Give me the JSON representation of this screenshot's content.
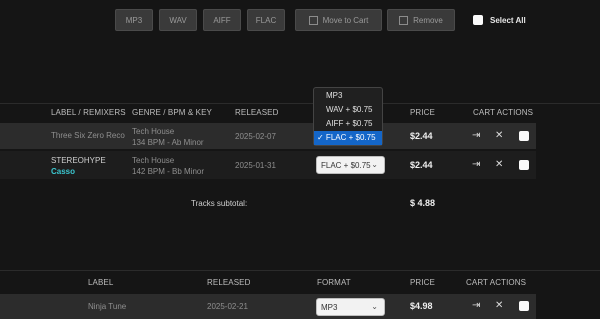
{
  "toolbar": {
    "formats": [
      "MP3",
      "WAV",
      "AIFF",
      "FLAC"
    ],
    "move_to_cart": "Move to Cart",
    "remove": "Remove",
    "select_all": "Select All"
  },
  "tracks_table": {
    "headers": {
      "label": "LABEL / REMIXERS",
      "genre": "GENRE / BPM & KEY",
      "released": "RELEASED",
      "price": "PRICE",
      "cart_actions": "CART ACTIONS"
    },
    "rows": [
      {
        "label": "Three Six Zero Reco",
        "remixer": "",
        "genre": "Tech House",
        "bpm_key": "134 BPM - Ab Minor",
        "released": "2025-02-07",
        "format": "FLAC + $0.75",
        "price": "$2.44"
      },
      {
        "label": "STEREOHYPE",
        "remixer": "Casso",
        "genre": "Tech House",
        "bpm_key": "142 BPM - Bb Minor",
        "released": "2025-01-31",
        "format": "FLAC + $0.75",
        "price": "$2.44"
      }
    ],
    "subtotal_label": "Tracks subtotal:",
    "subtotal_value": "$ 4.88",
    "format_dropdown": {
      "options": [
        "MP3",
        "WAV + $0.75",
        "AIFF + $0.75",
        "✓ FLAC + $0.75"
      ]
    }
  },
  "releases_table": {
    "headers": {
      "label": "LABEL",
      "released": "RELEASED",
      "format": "FORMAT",
      "price": "PRICE",
      "cart_actions": "CART ACTIONS"
    },
    "rows": [
      {
        "label": "Ninja Tune",
        "released": "2025-02-21",
        "format": "MP3",
        "price": "$4.98"
      }
    ]
  },
  "icons": {
    "move_to_cart": "move-to-cart-icon",
    "remove": "trash-icon",
    "close": "close-icon"
  }
}
